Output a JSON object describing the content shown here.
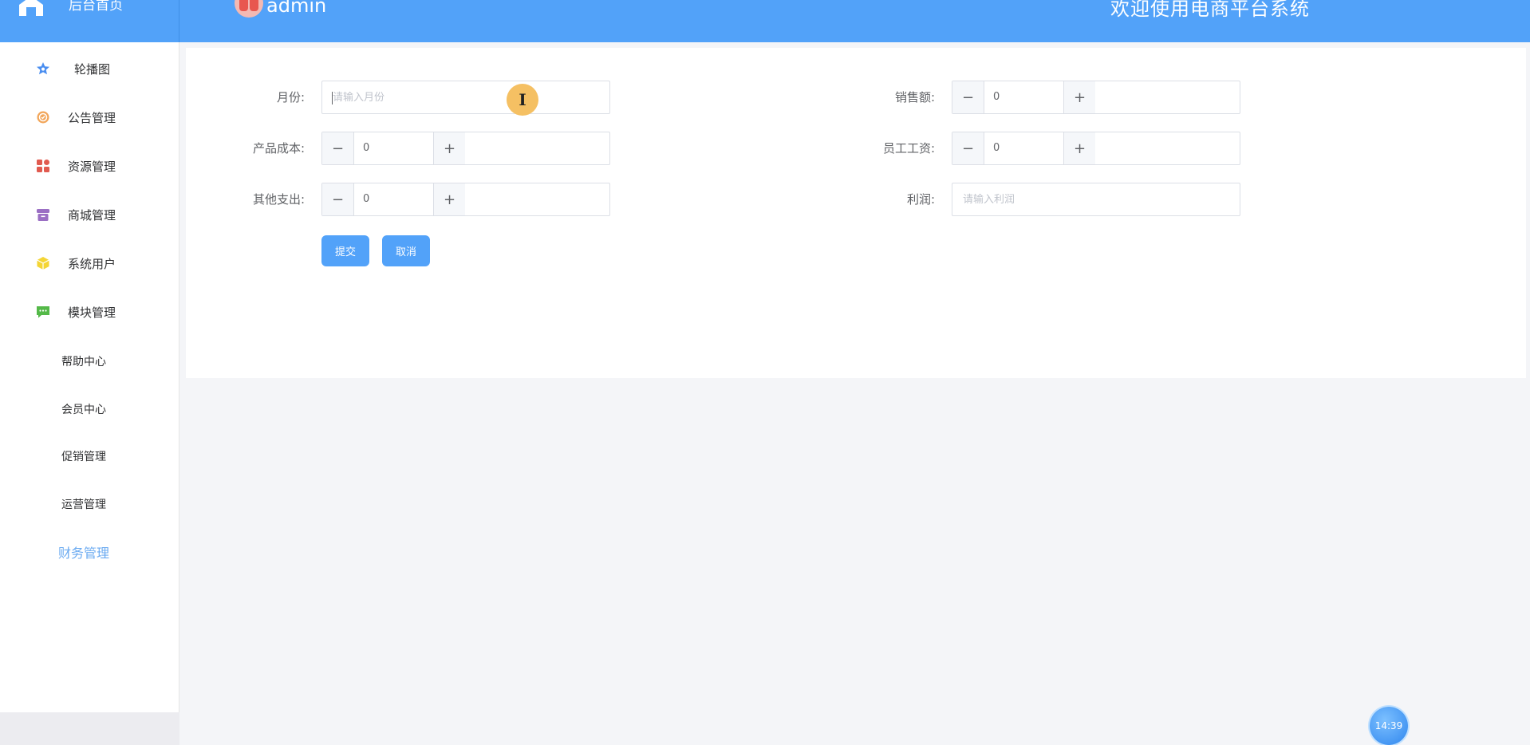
{
  "header": {
    "brand_label": "后台首页",
    "username": "admin",
    "welcome_text": "欢迎使用电商平台系统"
  },
  "sidebar": {
    "items": [
      {
        "label": "轮播图",
        "icon": "star-icon",
        "color": "#4a8ef0"
      },
      {
        "label": "公告管理",
        "icon": "badge-icon",
        "color": "#f2a65a"
      },
      {
        "label": "资源管理",
        "icon": "grid-icon",
        "color": "#e15a4f"
      },
      {
        "label": "商城管理",
        "icon": "box-icon",
        "color": "#9b6fc4"
      },
      {
        "label": "系统用户",
        "icon": "cube-icon",
        "color": "#f4d535"
      },
      {
        "label": "模块管理",
        "icon": "chat-icon",
        "color": "#54b948"
      }
    ],
    "sub_items": [
      {
        "label": "帮助中心"
      },
      {
        "label": "会员中心"
      },
      {
        "label": "促销管理"
      },
      {
        "label": "运营管理"
      },
      {
        "label": "财务管理",
        "active": true
      }
    ]
  },
  "form": {
    "month": {
      "label": "月份:",
      "placeholder": "请输入月份",
      "value": ""
    },
    "sales": {
      "label": "销售额:",
      "value": "0"
    },
    "product_cost": {
      "label": "产品成本:",
      "value": "0"
    },
    "staff_salary": {
      "label": "员工工资:",
      "value": "0"
    },
    "other_expense": {
      "label": "其他支出:",
      "value": "0"
    },
    "profit": {
      "label": "利润:",
      "placeholder": "请输入利润",
      "value": ""
    },
    "stepper_minus": "−",
    "stepper_plus": "+",
    "submit_label": "提交",
    "cancel_label": "取消"
  },
  "cursor_glyph": "I",
  "clock": "14:39",
  "colors": {
    "primary": "#52a2f9",
    "active_menu": "#6aaaf1"
  }
}
